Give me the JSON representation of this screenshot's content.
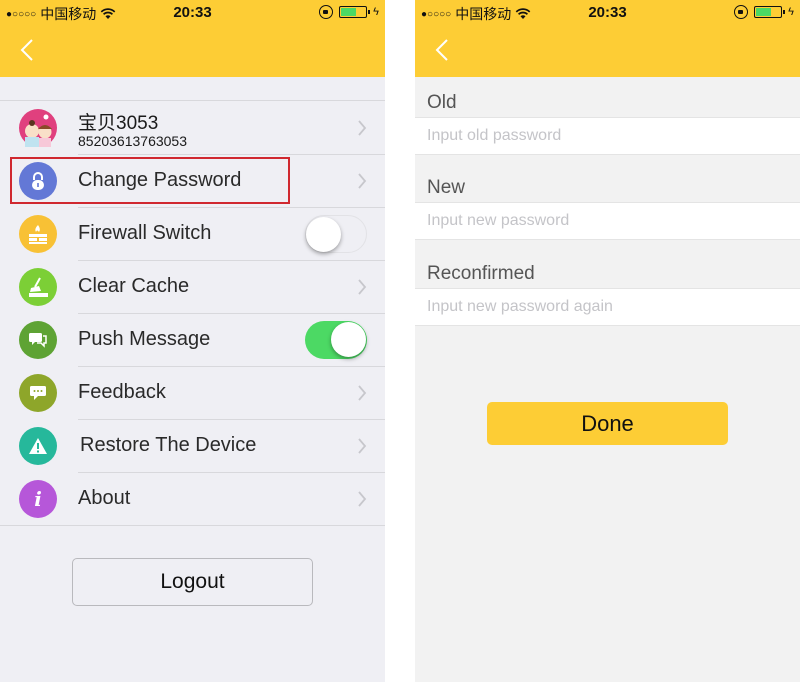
{
  "status_bar": {
    "signal": "●○○○○",
    "carrier": "中国移动",
    "time": "20:33",
    "battery_charging": "ϟ"
  },
  "colors": {
    "header": "#fdcd35",
    "toggle_on": "#4cd964",
    "highlight": "#d0282f"
  },
  "settings_screen": {
    "profile": {
      "name": "宝贝3053",
      "id": "85203613763053"
    },
    "items": [
      {
        "label": "Change Password",
        "icon": "lock-icon",
        "color": "#6378d6",
        "control": "chevron"
      },
      {
        "label": "Firewall Switch",
        "icon": "firewall-icon",
        "color": "#f8c135",
        "control": "toggle",
        "on": false
      },
      {
        "label": "Clear Cache",
        "icon": "broom-icon",
        "color": "#7ccf36",
        "control": "chevron"
      },
      {
        "label": "Push Message",
        "icon": "chat-icon",
        "color": "#5ea334",
        "control": "toggle",
        "on": true
      },
      {
        "label": "Feedback",
        "icon": "feedback-icon",
        "color": "#8ea62a",
        "control": "chevron"
      },
      {
        "label": "Restore The Device",
        "icon": "warning-icon",
        "color": "#26b89b",
        "control": "chevron"
      },
      {
        "label": "About",
        "icon": "info-icon",
        "color": "#b657d9",
        "control": "chevron"
      }
    ],
    "logout_label": "Logout"
  },
  "password_screen": {
    "fields": [
      {
        "label": "Old",
        "placeholder": "Input old password",
        "value": ""
      },
      {
        "label": "New",
        "placeholder": "Input new password",
        "value": ""
      },
      {
        "label": "Reconfirmed",
        "placeholder": "Input new password again",
        "value": ""
      }
    ],
    "done_label": "Done"
  }
}
